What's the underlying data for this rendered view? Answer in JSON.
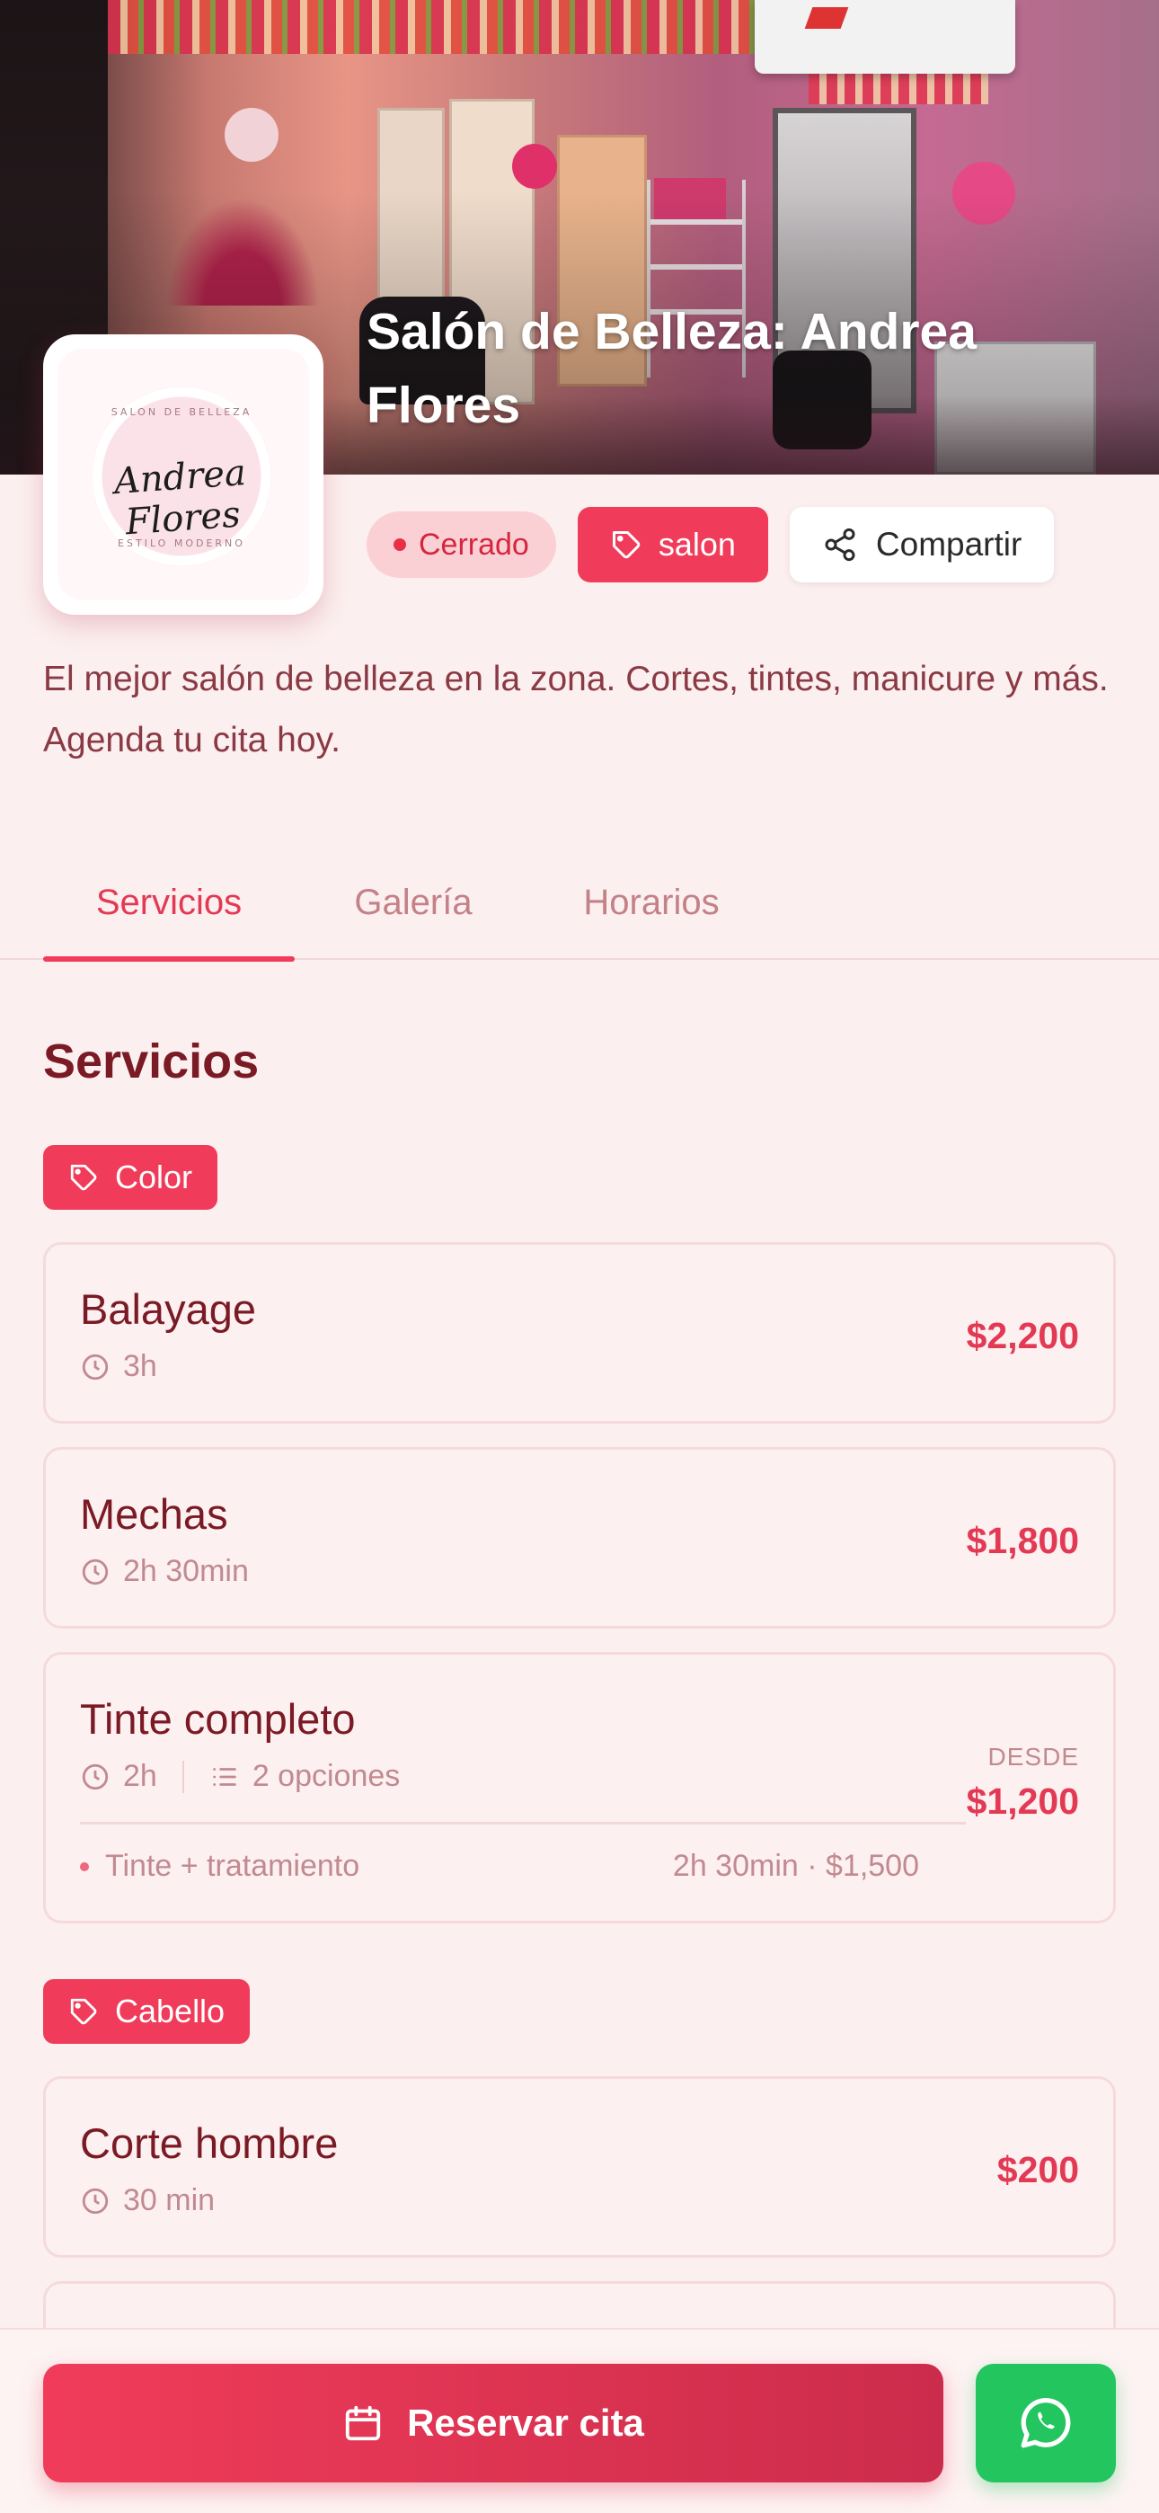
{
  "business": {
    "name": "Salón de Belleza: Andrea Flores",
    "description": "El mejor salón de belleza en la zona. Cortes, tintes, manicure y más. Agenda tu cita hoy.",
    "logo": {
      "script_text": "Andrea Flores",
      "top_text": "SALON DE BELLEZA",
      "bottom_text": "ESTILO MODERNO"
    }
  },
  "badges": {
    "status": "Cerrado",
    "category": "salon",
    "share": "Compartir"
  },
  "tabs": [
    {
      "label": "Servicios",
      "active": true
    },
    {
      "label": "Galería",
      "active": false
    },
    {
      "label": "Horarios",
      "active": false
    }
  ],
  "section_title": "Servicios",
  "categories": [
    {
      "label": "Color",
      "services": [
        {
          "name": "Balayage",
          "duration": "3h",
          "price": "$2,200"
        },
        {
          "name": "Mechas",
          "duration": "2h 30min",
          "price": "$1,800"
        },
        {
          "name": "Tinte completo",
          "duration": "2h",
          "options_label": "2 opciones",
          "price_prefix": "DESDE",
          "price": "$1,200",
          "option": {
            "name": "Tinte + tratamiento",
            "detail": "2h 30min · $1,500"
          }
        }
      ]
    },
    {
      "label": "Cabello",
      "services": [
        {
          "name": "Corte hombre",
          "duration": "30 min",
          "price": "$200"
        }
      ]
    }
  ],
  "actions": {
    "reserve": "Reservar cita",
    "whatsapp_icon": "whatsapp-icon"
  },
  "colors": {
    "accent": "#f03c5a",
    "background": "#fcefef",
    "text": "#7a1a25",
    "whatsapp": "#22c55e"
  }
}
